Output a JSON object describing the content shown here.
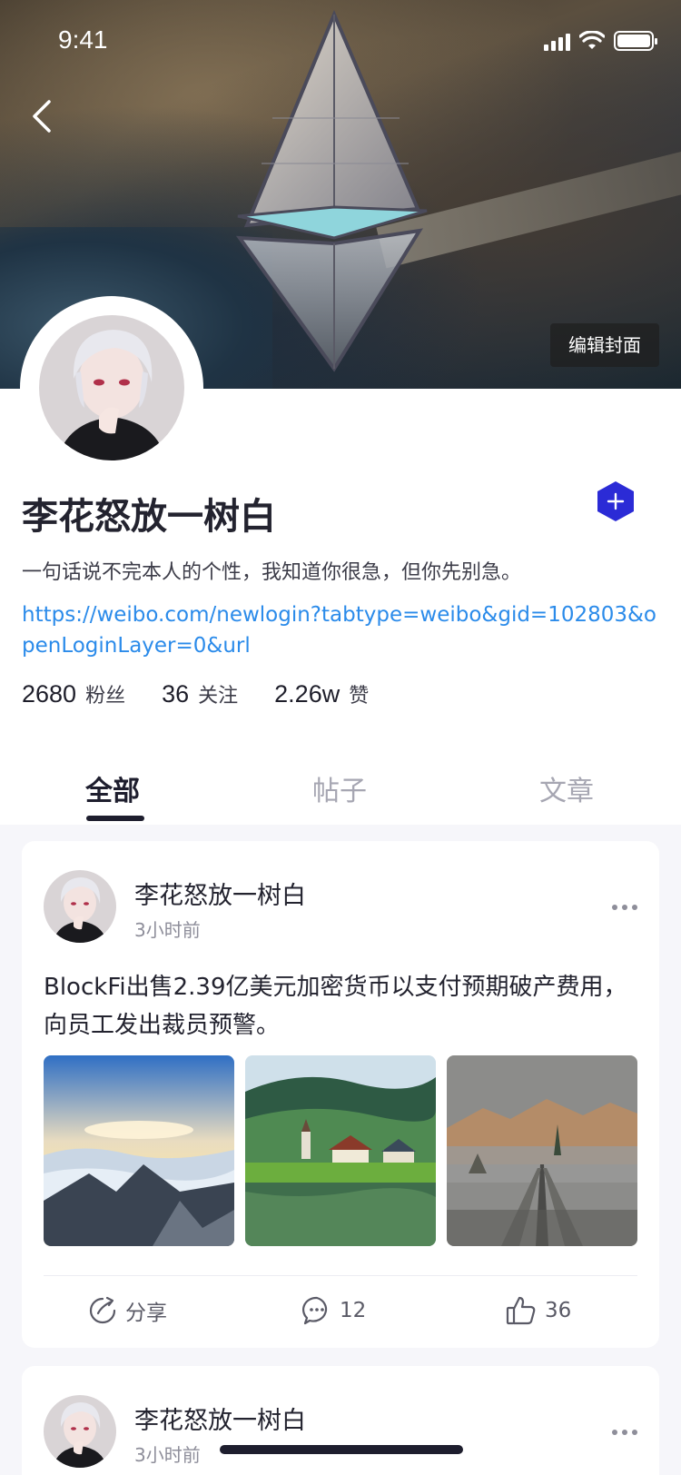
{
  "status": {
    "time": "9:41"
  },
  "cover": {
    "edit_label": "编辑封面"
  },
  "profile": {
    "name": "李花怒放一树白",
    "bio": "一句话说不完本人的个性，我知道你很急，但你先别急。",
    "link": "https://weibo.com/newlogin?tabtype=weibo&gid=102803&openLoginLayer=0&url",
    "stats": [
      {
        "num": "2680",
        "label": "粉丝"
      },
      {
        "num": "36",
        "label": "关注"
      },
      {
        "num": "2.26w",
        "label": "赞"
      }
    ],
    "badge_icon": "plus-hexagon-icon"
  },
  "tabs": [
    {
      "label": "全部",
      "active": true
    },
    {
      "label": "帖子",
      "active": false
    },
    {
      "label": "文章",
      "active": false
    }
  ],
  "posts": [
    {
      "author": "李花怒放一树白",
      "time": "3小时前",
      "text": "BlockFi出售2.39亿美元加密货币以支付预期破产费用，向员工发出裁员预警。",
      "images": [
        "sea-of-clouds-mountain",
        "alpine-village-lake",
        "foggy-bridge-mountains"
      ],
      "actions": {
        "share": "分享",
        "comments": "12",
        "likes": "36"
      }
    },
    {
      "author": "李花怒放一树白",
      "time": "3小时前"
    }
  ],
  "colors": {
    "accent": "#2b2bd6",
    "link": "#2b8bea",
    "text": "#23232f",
    "muted": "#8e8e9a"
  }
}
